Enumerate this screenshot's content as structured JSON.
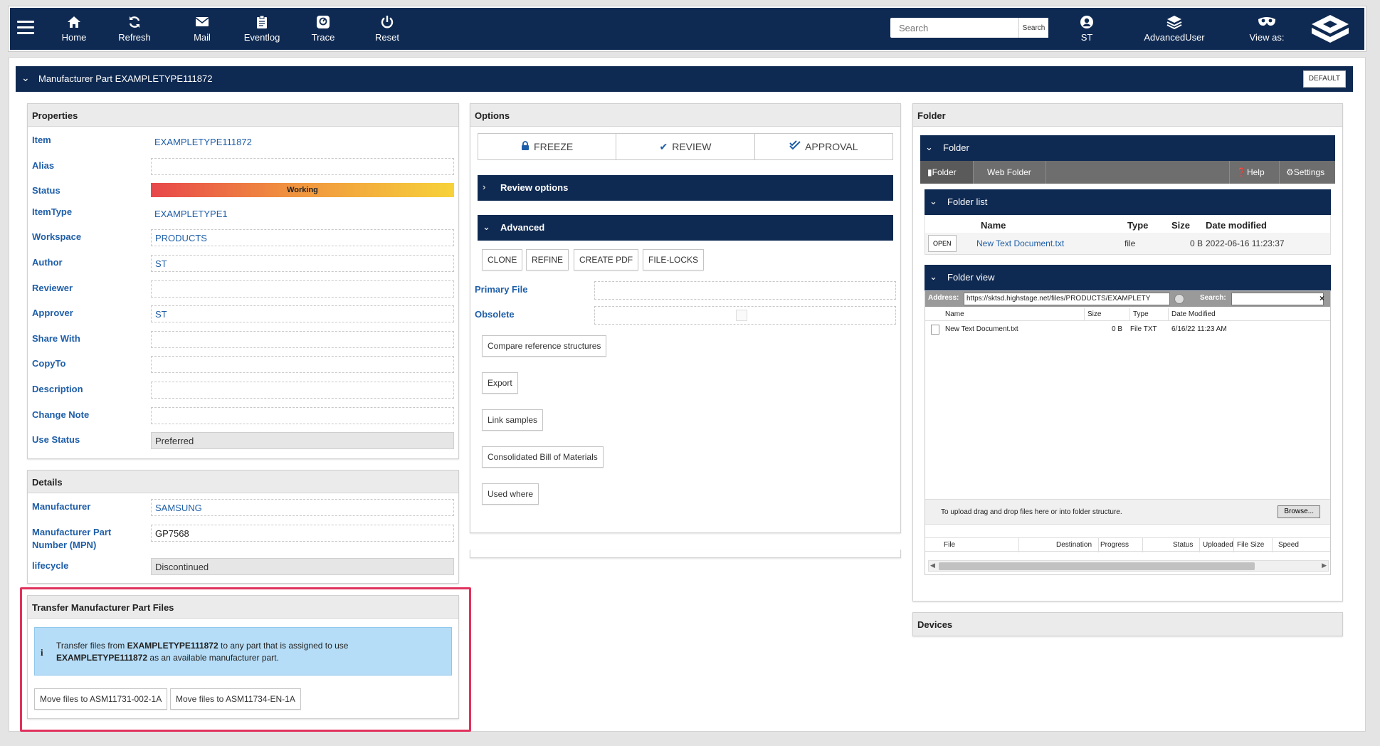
{
  "nav": {
    "items": [
      {
        "label": "Home",
        "icon": "home-icon"
      },
      {
        "label": "Refresh",
        "icon": "refresh-icon"
      },
      {
        "label": "Mail",
        "icon": "mail-icon"
      },
      {
        "label": "Eventlog",
        "icon": "clipboard-icon"
      },
      {
        "label": "Trace",
        "icon": "trace-icon"
      },
      {
        "label": "Reset",
        "icon": "power-icon"
      }
    ],
    "search_placeholder": "Search",
    "search_button": "Search",
    "user": {
      "label": "ST",
      "icon": "user-icon"
    },
    "role": {
      "label": "AdvancedUser",
      "icon": "layers-icon"
    },
    "view_as": {
      "label": "View as:",
      "icon": "mask-icon"
    }
  },
  "page": {
    "title": "Manufacturer Part EXAMPLETYPE111872",
    "default_button": "DEFAULT"
  },
  "properties": {
    "header": "Properties",
    "rows": [
      {
        "label": "Item",
        "value": "EXAMPLETYPE111872"
      },
      {
        "label": "Alias",
        "value": ""
      },
      {
        "label": "Status",
        "value": "Working"
      },
      {
        "label": "ItemType",
        "value": "EXAMPLETYPE1"
      },
      {
        "label": "Workspace",
        "value": "PRODUCTS"
      },
      {
        "label": "Author",
        "value": "ST"
      },
      {
        "label": "Reviewer",
        "value": ""
      },
      {
        "label": "Approver",
        "value": "ST"
      },
      {
        "label": "Share With",
        "value": ""
      },
      {
        "label": "CopyTo",
        "value": ""
      },
      {
        "label": "Description",
        "value": ""
      },
      {
        "label": "Change Note",
        "value": ""
      },
      {
        "label": "Use Status",
        "value": "Preferred"
      }
    ]
  },
  "details": {
    "header": "Details",
    "rows": [
      {
        "label": "Manufacturer",
        "value": "SAMSUNG"
      },
      {
        "label": "Manufacturer Part Number (MPN)",
        "value": "GP7568"
      },
      {
        "label": "lifecycle",
        "value": "Discontinued"
      }
    ]
  },
  "transfer": {
    "header": "Transfer Manufacturer Part Files",
    "info_prefix": "Transfer files from ",
    "info_part": "EXAMPLETYPE111872",
    "info_mid": " to any part that is assigned to use",
    "info_part2": "EXAMPLETYPE111872",
    "info_suffix": " as an available manufacturer part.",
    "buttons": [
      "Move files to ASM11731-002-1A",
      "Move files to ASM11734-EN-1A"
    ]
  },
  "options": {
    "header": "Options",
    "segments": [
      {
        "label": "FREEZE",
        "icon": "lock-icon"
      },
      {
        "label": "REVIEW",
        "icon": "check-icon"
      },
      {
        "label": "APPROVAL",
        "icon": "double-check-icon"
      }
    ],
    "review_options": "Review options",
    "advanced": "Advanced",
    "adv_buttons": [
      "CLONE",
      "REFINE",
      "CREATE PDF",
      "FILE-LOCKS"
    ],
    "primary_file": "Primary File",
    "obsolete": "Obsolete",
    "action_buttons": [
      "Compare reference structures",
      "Export",
      "Link samples",
      "Consolidated Bill of Materials",
      "Used where"
    ]
  },
  "folder": {
    "header": "Folder",
    "inner_title": "Folder",
    "tabs": {
      "folder": "Folder",
      "web_folder": "Web Folder",
      "help": "Help",
      "settings": "Settings"
    },
    "list_title": "Folder list",
    "list_columns": [
      "Name",
      "Type",
      "Size",
      "Date modified"
    ],
    "list_rows": [
      {
        "open": "OPEN",
        "name": "New Text Document.txt",
        "type": "file",
        "size": "0 B",
        "date": "2022-06-16 11:23:37"
      }
    ],
    "view_title": "Folder view",
    "address_label": "Address:",
    "address_value": "https://sktsd.highstage.net/files/PRODUCTS/EXAMPLETY",
    "search_label": "Search:",
    "grid_columns": [
      "Name",
      "Size",
      "Type",
      "Date Modified"
    ],
    "grid_rows": [
      {
        "name": "New Text Document.txt",
        "size": "0 B",
        "type": "File TXT",
        "date": "6/16/22 11:23 AM"
      }
    ],
    "upload_text": "To upload drag and drop files here or into folder structure.",
    "browse": "Browse...",
    "upload_columns": [
      "File",
      "Destination",
      "Progress",
      "Status",
      "Uploaded",
      "File Size",
      "Speed"
    ]
  },
  "devices": {
    "header": "Devices"
  }
}
